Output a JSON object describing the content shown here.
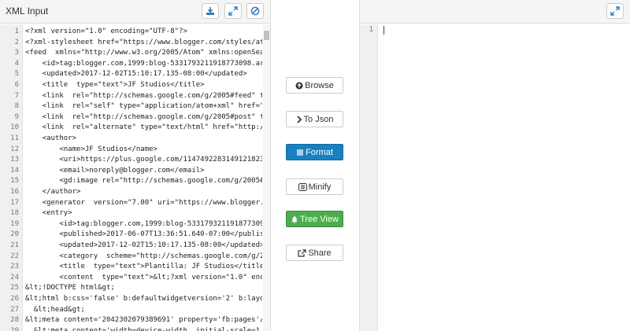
{
  "left_panel": {
    "title": "XML Input",
    "line_numbers": [
      "1",
      "2",
      "3",
      "4",
      "5",
      "6",
      "7",
      "8",
      "9",
      "10",
      "11",
      "12",
      "13",
      "14",
      "15",
      "16",
      "17",
      "18",
      "19",
      "20",
      "21",
      "22",
      "23",
      "24",
      "25",
      "26",
      "27",
      "28",
      "29"
    ],
    "lines": [
      "<?xml version=\"1.0\" encoding=\"UTF-8\"?>",
      "<?xml-stylesheet href=\"https://www.blogger.com/styles/atc",
      "<feed  xmlns=\"http://www.w3.org/2005/Atom\" xmlns:openSear",
      "    <id>tag:blogger.com,1999:blog-5331793211918773098.arc",
      "    <updated>2017-12-02T15:10:17.135-08:00</updated>",
      "    <title  type=\"text\">JF Studios</title>",
      "    <link  rel=\"http://schemas.google.com/g/2005#feed\" ty",
      "    <link  rel=\"self\" type=\"application/atom+xml\" href=\"h",
      "    <link  rel=\"http://schemas.google.com/g/2005#post\" ty",
      "    <link  rel=\"alternate\" type=\"text/html\" href=\"http://",
      "    <author>",
      "        <name>JF Studios</name>",
      "        <uri>https://plus.google.com/1147492283149121823",
      "        <email>noreply@blogger.com</email>",
      "        <gd:image rel=\"http://schemas.google.com/g/2005#t",
      "    </author>",
      "    <generator  version=\"7.00\" uri=\"https://www.blogger.c",
      "    <entry>",
      "        <id>tag:blogger.com,1999:blog-533179321191877309",
      "        <published>2017-06-07T13:36:51.640-07:00</publish",
      "        <updated>2017-12-02T15:10:17.135-08:00</updated>",
      "        <category  scheme=\"http://schemas.google.com/g/20",
      "        <title  type=\"text\">Plantilla: JF Studios</title>",
      "        <content  type=\"text\">&lt;?xml version=\"1.0\" enco",
      "&lt;!DOCTYPE html&gt;",
      "&lt;html b:css='false' b:defaultwidgetversion='2' b:layou",
      "  &lt;head&gt;",
      "&lt;meta content='2042302079389691' property='fb:pages'/&",
      "  &lt;meta content='width=device-width, initial-scale=1"
    ]
  },
  "right_panel": {
    "line_numbers": [
      "1"
    ]
  },
  "actions": {
    "browse": "Browse",
    "to_json": "To Json",
    "format": "Format",
    "minify": "Minify",
    "tree_view": "Tree View",
    "share": "Share"
  },
  "colors": {
    "format_button": "#1a80c2",
    "tree_view_button": "#4cae4c",
    "icon_blue": "#337ab7"
  }
}
